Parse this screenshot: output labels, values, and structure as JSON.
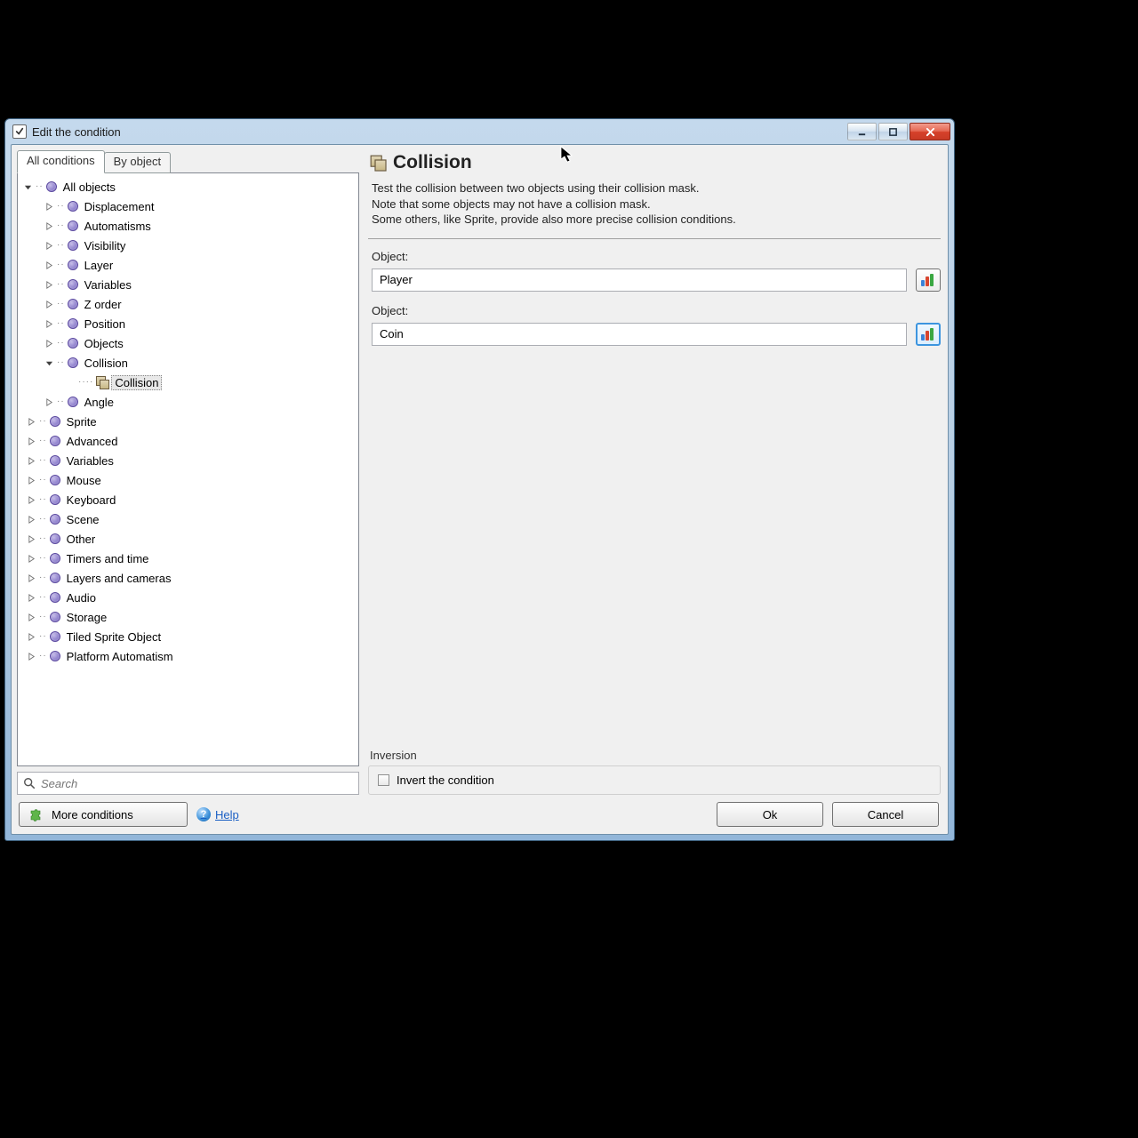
{
  "titlebar": {
    "title": "Edit the condition"
  },
  "tabs": {
    "all": "All conditions",
    "by_object": "By object"
  },
  "tree": {
    "root": "All objects",
    "children": {
      "displacement": "Displacement",
      "automatisms": "Automatisms",
      "visibility": "Visibility",
      "layer": "Layer",
      "variables": "Variables",
      "zorder": "Z order",
      "position": "Position",
      "objects": "Objects",
      "collision": "Collision",
      "collision_leaf": "Collision",
      "angle": "Angle"
    },
    "top": {
      "sprite": "Sprite",
      "advanced": "Advanced",
      "variables2": "Variables",
      "mouse": "Mouse",
      "keyboard": "Keyboard",
      "scene": "Scene",
      "other": "Other",
      "timers": "Timers and time",
      "layers": "Layers and cameras",
      "audio": "Audio",
      "storage": "Storage",
      "tiled": "Tiled Sprite Object",
      "platform": "Platform Automatism"
    }
  },
  "search": {
    "placeholder": "Search"
  },
  "detail": {
    "heading": "Collision",
    "desc_line1": "Test the collision between two objects using their collision mask.",
    "desc_line2": "Note that some objects may not have a collision mask.",
    "desc_line3": "Some others, like Sprite, provide also more precise collision conditions.",
    "field1_label": "Object:",
    "field1_value": "Player",
    "field2_label": "Object:",
    "field2_value": "Coin",
    "inversion_title": "Inversion",
    "inversion_label": "Invert the condition"
  },
  "footer": {
    "more": "More conditions",
    "help": "Help",
    "ok": "Ok",
    "cancel": "Cancel"
  }
}
